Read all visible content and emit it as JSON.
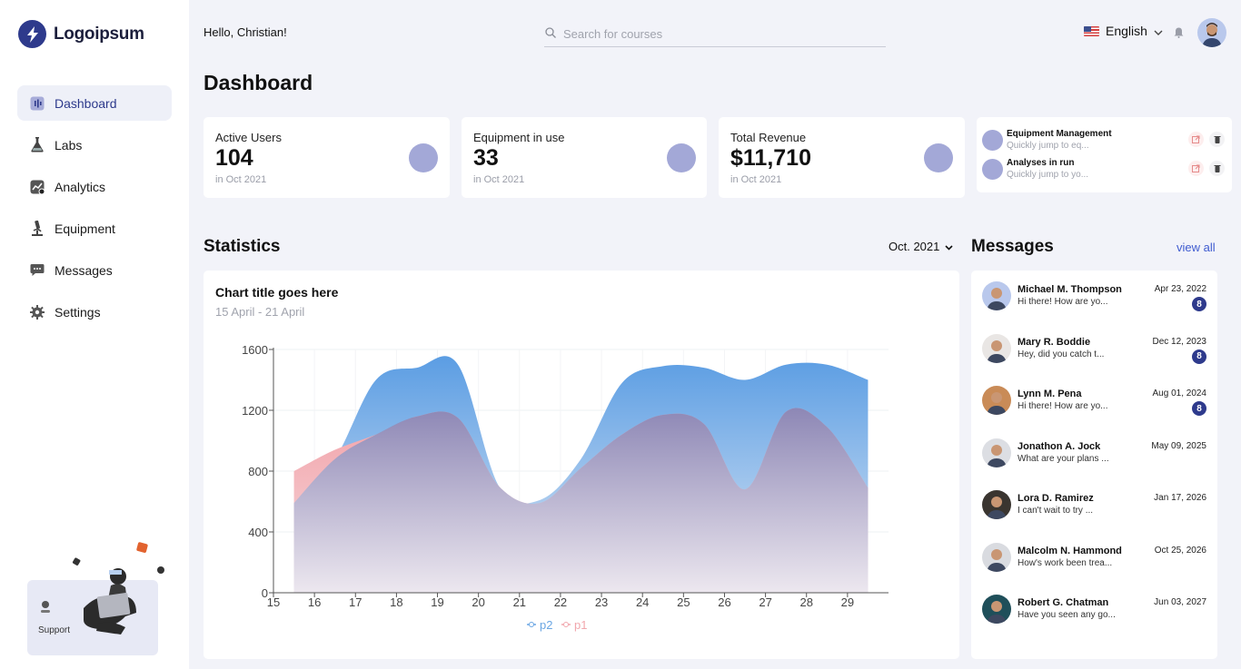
{
  "brand": {
    "name": "Logoipsum",
    "accent": "#2e3a8c"
  },
  "sidebar": {
    "items": [
      {
        "label": "Dashboard",
        "icon": "dashboard-icon",
        "active": true
      },
      {
        "label": "Labs",
        "icon": "flask-icon"
      },
      {
        "label": "Analytics",
        "icon": "analytics-icon"
      },
      {
        "label": "Equipment",
        "icon": "microscope-icon"
      },
      {
        "label": "Messages",
        "icon": "chat-icon"
      },
      {
        "label": "Settings",
        "icon": "gear-icon"
      }
    ],
    "support_label": "Support"
  },
  "header": {
    "greeting": "Hello, Christian!",
    "search_placeholder": "Search for courses",
    "language": "English"
  },
  "page_title": "Dashboard",
  "stats": [
    {
      "label": "Active Users",
      "value": "104",
      "sub": "in Oct 2021"
    },
    {
      "label": "Equipment in use",
      "value": "33",
      "sub": "in Oct 2021"
    },
    {
      "label": "Total Revenue",
      "value": "$11,710",
      "sub": "in Oct 2021"
    }
  ],
  "quick_links": [
    {
      "title": "Equipment Management",
      "subtitle": "Quickly jump to eq..."
    },
    {
      "title": "Analyses in run",
      "subtitle": "Quickly jump to yo..."
    }
  ],
  "statistics": {
    "title": "Statistics",
    "month": "Oct. 2021",
    "chart_title": "Chart title goes here",
    "chart_subtitle": "15 April - 21 April"
  },
  "chart_data": {
    "type": "area",
    "x": [
      15.5,
      16.5,
      17.5,
      18.5,
      19.5,
      20.5,
      21.5,
      22.5,
      23.5,
      24.5,
      25.5,
      26.5,
      27.5,
      28.5,
      29.5
    ],
    "xticks": [
      15,
      16,
      17,
      18,
      19,
      20,
      21,
      22,
      23,
      24,
      25,
      26,
      27,
      28,
      29
    ],
    "yticks": [
      0,
      400,
      800,
      1200,
      1600
    ],
    "ylim": [
      0,
      1600
    ],
    "xlim": [
      15,
      30
    ],
    "series": [
      {
        "name": "p2",
        "color": "#6aa6e3",
        "values": [
          590,
          880,
          1400,
          1480,
          1500,
          700,
          610,
          880,
          1380,
          1490,
          1480,
          1400,
          1500,
          1500,
          1400
        ]
      },
      {
        "name": "p1",
        "color": "#f1a7ad",
        "values": [
          800,
          940,
          1040,
          1160,
          1150,
          700,
          590,
          820,
          1040,
          1170,
          1110,
          680,
          1190,
          1090,
          690
        ]
      }
    ],
    "legend_position": "bottom"
  },
  "messages": {
    "title": "Messages",
    "view_all": "view all",
    "items": [
      {
        "name": "Michael M. Thompson",
        "preview": "Hi there! How are yo...",
        "date": "Apr 23, 2022",
        "badge": "8",
        "avatar_bg": "#b9c8ec"
      },
      {
        "name": "Mary R. Boddie",
        "preview": "Hey, did you catch t...",
        "date": "Dec 12, 2023",
        "badge": "8",
        "avatar_bg": "#e9e6e4"
      },
      {
        "name": "Lynn M. Pena",
        "preview": "Hi there! How are yo...",
        "date": "Aug 01, 2024",
        "badge": "8",
        "avatar_bg": "#c98b57"
      },
      {
        "name": "Jonathon A. Jock",
        "preview": "What are your plans ...",
        "date": "May 09, 2025",
        "avatar_bg": "#dcdee3"
      },
      {
        "name": "Lora D. Ramirez",
        "preview": "I can't wait to try ...",
        "date": "Jan 17, 2026",
        "avatar_bg": "#3a3530"
      },
      {
        "name": "Malcolm N. Hammond",
        "preview": "How's work been trea...",
        "date": "Oct 25, 2026",
        "avatar_bg": "#d9dbe0"
      },
      {
        "name": "Robert G. Chatman",
        "preview": "Have you seen any go...",
        "date": "Jun 03, 2027",
        "avatar_bg": "#1f4f5a"
      }
    ]
  }
}
